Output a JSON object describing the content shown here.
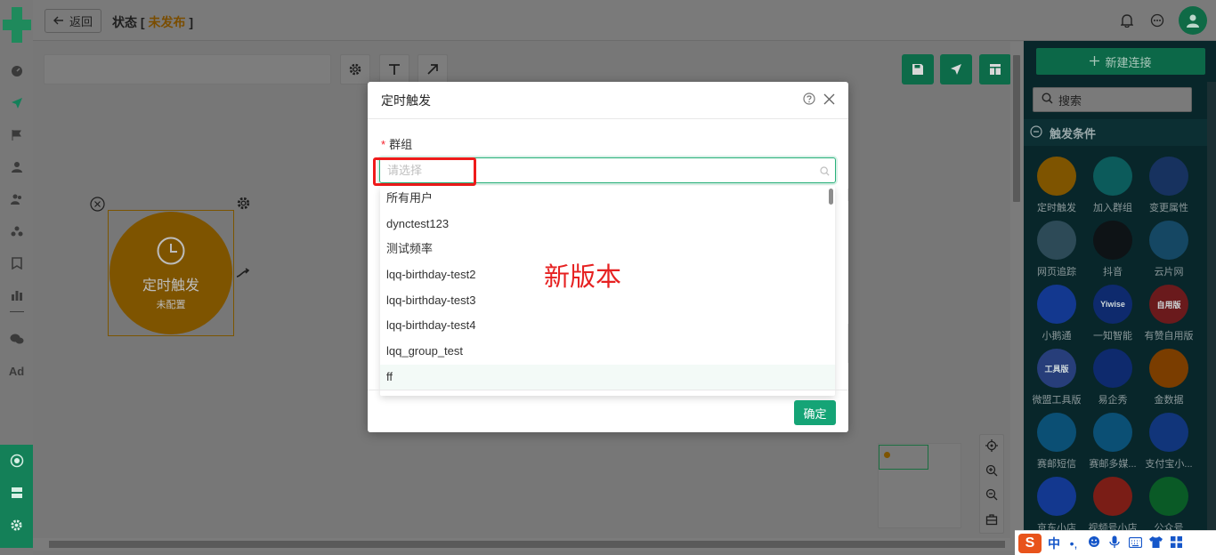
{
  "header": {
    "back_label": "返回",
    "status_label": "状态",
    "status_value": "未发布",
    "status_bracket_open": "[",
    "status_bracket_close": "]"
  },
  "canvas": {
    "node": {
      "title": "定时触发",
      "subtitle": "未配置"
    }
  },
  "right_panel": {
    "new_connection": "新建连接",
    "search_placeholder": "搜索",
    "section_title": "触发条件",
    "items": [
      {
        "label": "定时触发",
        "icon": "clock-icon",
        "color": "#7e5400"
      },
      {
        "label": "加入群组",
        "icon": "user-add-icon",
        "color": "#0c5b5b"
      },
      {
        "label": "变更属性",
        "icon": "edit-icon",
        "color": "#17325f"
      },
      {
        "label": "网页追踪",
        "icon": "web-track-icon",
        "color": "#2d4a57"
      },
      {
        "label": "抖音",
        "icon": "tiktok-icon",
        "color": "#0e1316"
      },
      {
        "label": "云片网",
        "icon": "cloud-icon",
        "color": "#154763"
      },
      {
        "label": "小鹅通",
        "icon": "xiaoetong-icon",
        "color": "#13388f"
      },
      {
        "label": "一知智能",
        "icon": "yiwise-icon",
        "color": "#0e2a6d",
        "badge": "Yiwise"
      },
      {
        "label": "有赞自用版",
        "icon": "youzan-icon",
        "color": "#6a1a1c",
        "badge": "自用版"
      },
      {
        "label": "微盟工具版",
        "icon": "weimob-icon",
        "color": "#273e7a",
        "badge": "工具版"
      },
      {
        "label": "易企秀",
        "icon": "eqxiu-icon",
        "color": "#0e2a6d"
      },
      {
        "label": "金数据",
        "icon": "jinshuju-icon",
        "color": "#7a3d00"
      },
      {
        "label": "赛邮短信",
        "icon": "submail-icon",
        "color": "#0b4f74"
      },
      {
        "label": "赛邮多媒...",
        "icon": "submail-mm-icon",
        "color": "#0b4f74"
      },
      {
        "label": "支付宝小...",
        "icon": "alipay-icon",
        "color": "#11357a"
      },
      {
        "label": "京东小店",
        "icon": "chat-box-icon",
        "color": "#13388f"
      },
      {
        "label": "视频号小店",
        "icon": "shop-bag-icon",
        "color": "#7a1d16"
      },
      {
        "label": "公众号",
        "icon": "wechat-icon",
        "color": "#0a5a26"
      }
    ]
  },
  "modal": {
    "title": "定时触发",
    "field_label": "群组",
    "required_mark": "*",
    "input_placeholder": "请选择",
    "options": [
      "所有用户",
      "dynctest123",
      "测试频率",
      "lqq-birthday-test2",
      "lqq-birthday-test3",
      "lqq-birthday-test4",
      "lqq_group_test",
      "ff"
    ],
    "annotation": "新版本",
    "ok_label": "确定"
  },
  "ime": {
    "logo": "S",
    "mode": "中",
    "punct": "•,"
  }
}
